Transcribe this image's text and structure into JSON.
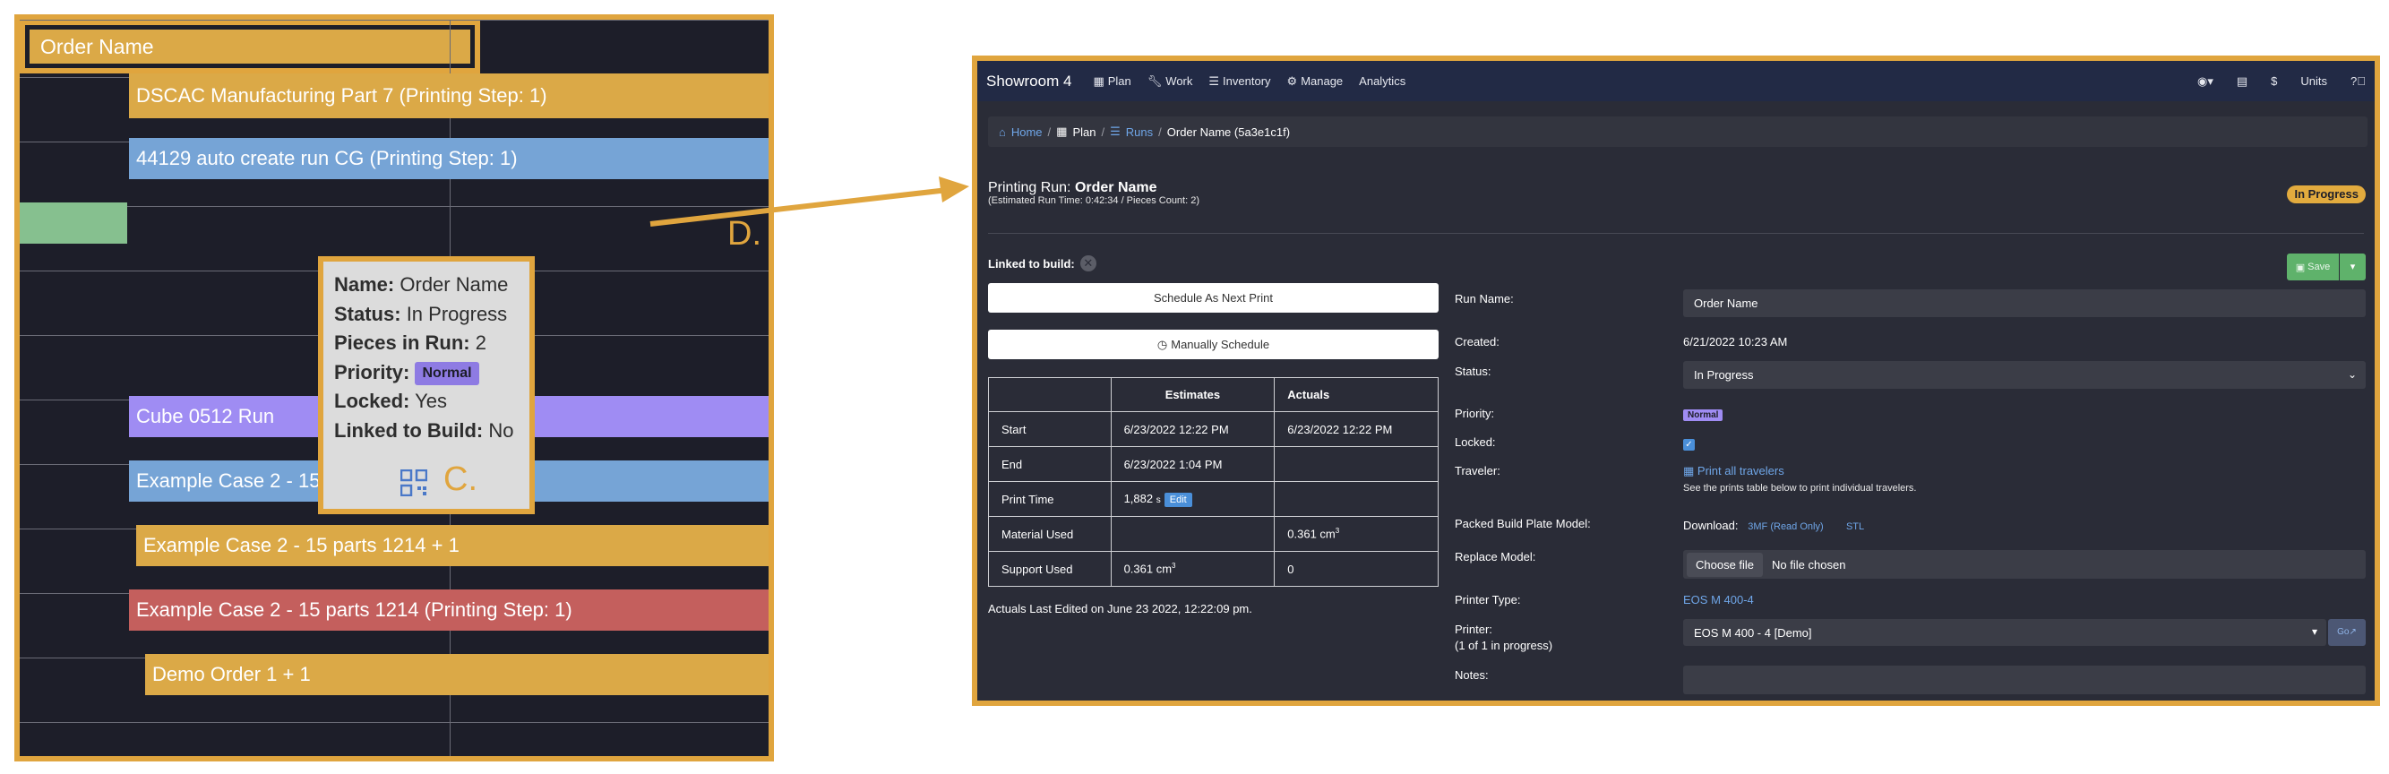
{
  "gantt": {
    "bars": [
      {
        "label": "DSCAC Manufacturing Part 7 (Printing Step: 1)"
      },
      {
        "label": "44129 auto create run CG (Printing Step: 1)"
      },
      {
        "label": "Order Name"
      },
      {
        "label": "Cube 0512 Run"
      },
      {
        "label": "Example Case 2 - 15 parts 12"
      },
      {
        "label": "Example Case 2 - 15 parts 1214 + 1"
      },
      {
        "label": "Example Case 2 - 15 parts 1214 (Printing Step: 1)"
      },
      {
        "label": "Demo Order 1 + 1"
      }
    ],
    "annotation_d": "D.",
    "tooltip": {
      "name_label": "Name:",
      "name_value": "Order Name",
      "status_label": "Status:",
      "status_value": "In Progress",
      "pieces_label": "Pieces in Run:",
      "pieces_value": "2",
      "priority_label": "Priority:",
      "priority_value": "Normal",
      "locked_label": "Locked:",
      "locked_value": "Yes",
      "linked_label": "Linked to Build:",
      "linked_value": "No",
      "annotation_c": "C."
    },
    "colors": {
      "yellow": "#dba947",
      "blue": "#76a4d6",
      "purple": "#9f8cf3",
      "red": "#c45f5d",
      "green": "#86c08f",
      "highlight": "#e0a53e"
    }
  },
  "app": {
    "brand": "Showroom 4",
    "nav": [
      {
        "label": "Plan",
        "icon": "calendar-icon"
      },
      {
        "label": "Work",
        "icon": "wrench-icon"
      },
      {
        "label": "Inventory",
        "icon": "list-icon"
      },
      {
        "label": "Manage",
        "icon": "gear-icon"
      },
      {
        "label": "Analytics",
        "icon": ""
      }
    ],
    "nav_right": {
      "user_icon": "user-icon",
      "flag_icon": "us-flag-icon",
      "currency": "$",
      "units": "Units",
      "help_icon": "question-icon"
    },
    "breadcrumb": {
      "home": "Home",
      "plan": "Plan",
      "runs": "Runs",
      "current": "Order Name (5a3e1c1f)"
    },
    "header": {
      "title_prefix": "Printing Run:",
      "title_name": "Order Name",
      "subtitle": "(Estimated Run Time: 0:42:34 / Pieces Count: 2)",
      "status": "In Progress"
    },
    "linked_label": "Linked to build:",
    "save_label": "Save",
    "schedule_next_label": "Schedule As Next Print",
    "manual_schedule_label": "Manually Schedule",
    "table": {
      "headers": [
        "",
        "Estimates",
        "Actuals"
      ],
      "rows": [
        {
          "label": "Start",
          "estimate": "6/23/2022 12:22 PM",
          "actual": "6/23/2022 12:22 PM"
        },
        {
          "label": "End",
          "estimate": "6/23/2022 1:04 PM",
          "actual": ""
        },
        {
          "label": "Print Time",
          "estimate": "1,882",
          "estimate_unit": "s",
          "edit_label": "Edit",
          "actual": ""
        },
        {
          "label": "Material Used",
          "estimate": "",
          "actual": "0.361 cm",
          "actual_sup": "3"
        },
        {
          "label": "Support Used",
          "estimate": "0.361 cm",
          "estimate_sup": "3",
          "actual": "0"
        }
      ]
    },
    "last_edited": "Actuals Last Edited on June 23 2022, 12:22:09 pm.",
    "form": {
      "run_name_label": "Run Name:",
      "run_name_value": "Order Name",
      "created_label": "Created:",
      "created_value": "6/21/2022 10:23 AM",
      "status_label": "Status:",
      "status_value": "In Progress",
      "priority_label": "Priority:",
      "priority_value": "Normal",
      "locked_label": "Locked:",
      "traveler_label": "Traveler:",
      "traveler_link": "Print all travelers",
      "traveler_hint": "See the prints table below to print individual travelers.",
      "packed_label": "Packed Build Plate Model:",
      "download_label": "Download:",
      "download_3mf": "3MF (Read Only)",
      "download_stl": "STL",
      "replace_label": "Replace Model:",
      "choose_file": "Choose file",
      "no_file": "No file chosen",
      "printer_type_label": "Printer Type:",
      "printer_type_value": "EOS M 400-4",
      "printer_label": "Printer:",
      "printer_sub": "(1 of 1 in progress)",
      "printer_value": "EOS M 400 - 4 [Demo]",
      "go_label": "Go",
      "notes_label": "Notes:"
    }
  }
}
